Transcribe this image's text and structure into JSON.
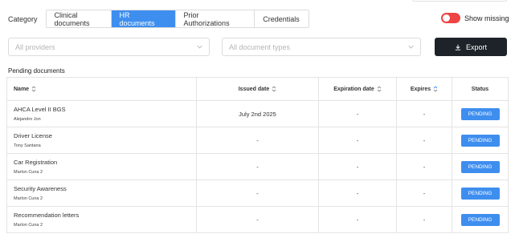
{
  "header": {
    "category_label": "Category",
    "tabs": [
      {
        "label": "Clinical documents",
        "active": false
      },
      {
        "label": "HR documents",
        "active": true
      },
      {
        "label": "Prior Authorizations",
        "active": false
      },
      {
        "label": "Credentials",
        "active": false
      }
    ],
    "show_missing": {
      "label": "Show missing",
      "on": true,
      "color": "#ef4444"
    }
  },
  "filters": {
    "providers_placeholder": "All providers",
    "types_placeholder": "All document types",
    "export_label": "Export"
  },
  "section_title": "Pending documents",
  "table": {
    "columns": [
      "Name",
      "Issued date",
      "Expiration date",
      "Expires",
      "Status"
    ],
    "rows": [
      {
        "name": "AHCA Level II BGS",
        "person": "Alejandro Jon",
        "issued": "July 2nd 2025",
        "expiration": "-",
        "expires": "-",
        "status": "PENDING"
      },
      {
        "name": "Driver License",
        "person": "Tony Santana",
        "issued": "-",
        "expiration": "-",
        "expires": "-",
        "status": "PENDING"
      },
      {
        "name": "Car Registration",
        "person": "Marlon Cuna 2",
        "issued": "-",
        "expiration": "-",
        "expires": "-",
        "status": "PENDING"
      },
      {
        "name": "Security Awareness",
        "person": "Marlon Cuna 2",
        "issued": "-",
        "expiration": "-",
        "expires": "-",
        "status": "PENDING"
      },
      {
        "name": "Recommendation letters",
        "person": "Marlon Cuna 2",
        "issued": "-",
        "expiration": "-",
        "expires": "-",
        "status": "PENDING"
      }
    ]
  },
  "colors": {
    "accent": "#3e8eef",
    "export_bg": "#1e2329",
    "toggle": "#ef4444"
  },
  "icons": {
    "export": "download-icon",
    "sort": "sort-icon",
    "chevron": "chevron-down-icon"
  }
}
